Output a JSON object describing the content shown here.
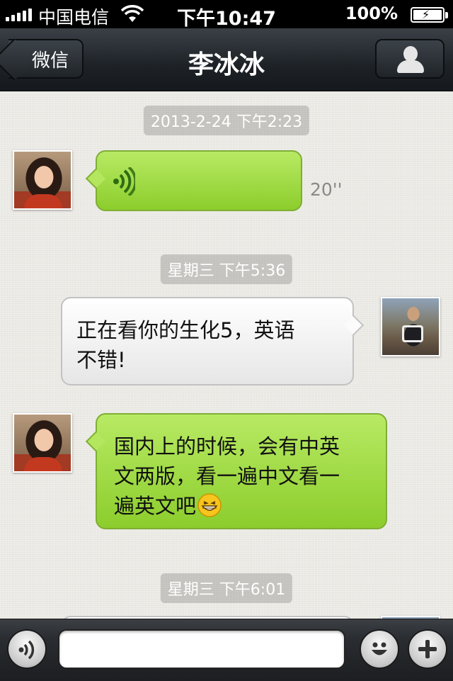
{
  "status_bar": {
    "carrier": "中国电信",
    "time": "下午10:47",
    "battery": "100%"
  },
  "nav": {
    "back_label": "微信",
    "title": "李冰冰"
  },
  "chat": {
    "timestamps": [
      "2013-2-24 下午2:23",
      "星期三 下午5:36",
      "星期三 下午6:01"
    ],
    "messages": [
      {
        "sender": "contact",
        "type": "voice",
        "duration": "20''"
      },
      {
        "sender": "self",
        "type": "text",
        "line1": "正在看你的生化5，英语",
        "line2": "不错!"
      },
      {
        "sender": "contact",
        "type": "text",
        "line1": "国内上的时候，会有中英",
        "line2": "文两版，看一遍中文看一",
        "line3": "遍英文吧",
        "emoji": "grinning-face"
      }
    ]
  },
  "toolbar": {
    "input_value": "",
    "voice_button": "voice-icon",
    "emoji_button": "smiley-icon",
    "plus_button": "plus-icon"
  },
  "colors": {
    "green_bubble": "#a4dc48",
    "white_bubble": "#f4f4f4",
    "navbar": "#23282d"
  }
}
